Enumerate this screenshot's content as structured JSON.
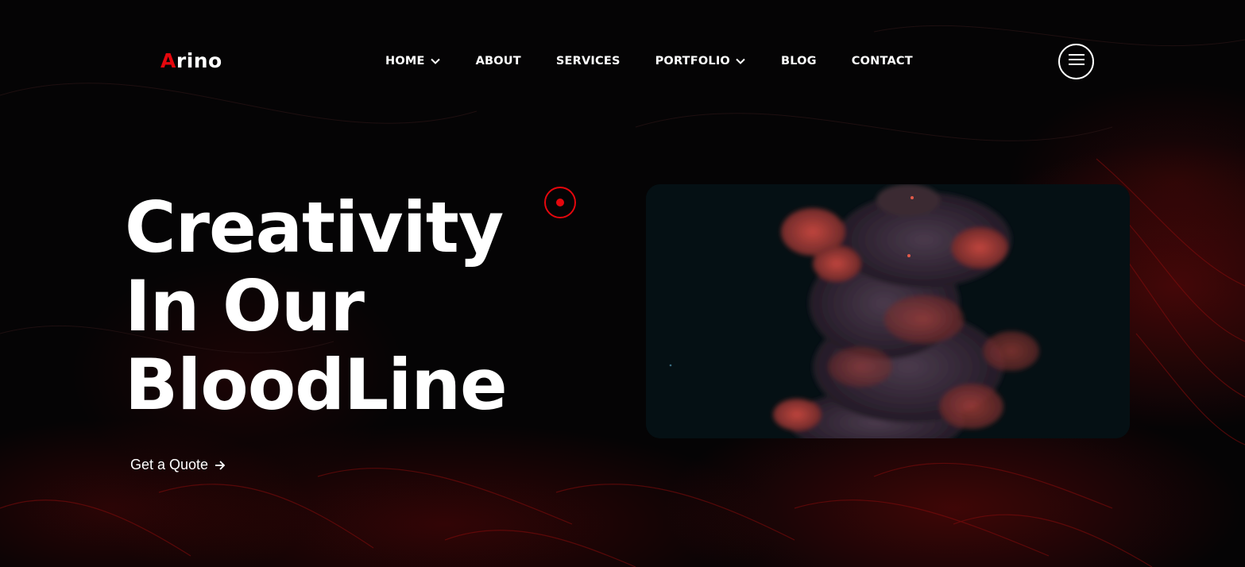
{
  "brand": {
    "logo_first": "A",
    "logo_rest": "rino",
    "accent": "#e5070d"
  },
  "nav": {
    "items": [
      {
        "label": "HOME",
        "has_dropdown": true
      },
      {
        "label": "ABOUT",
        "has_dropdown": false
      },
      {
        "label": "SERVICES",
        "has_dropdown": false
      },
      {
        "label": "PORTFOLIO",
        "has_dropdown": true
      },
      {
        "label": "BLOG",
        "has_dropdown": false
      },
      {
        "label": "CONTACT",
        "has_dropdown": false
      }
    ],
    "menu_icon": "hamburger-icon"
  },
  "hero": {
    "headline": [
      "Creativity",
      "In Our",
      "BloodLine"
    ],
    "cta_label": "Get a Quote",
    "cta_icon": "arrow-right-icon",
    "image": "red-smoke-ink-image"
  },
  "colors": {
    "background": "#050405",
    "text": "#ffffff",
    "accent": "#e5070d",
    "image_bg": "#051014"
  }
}
